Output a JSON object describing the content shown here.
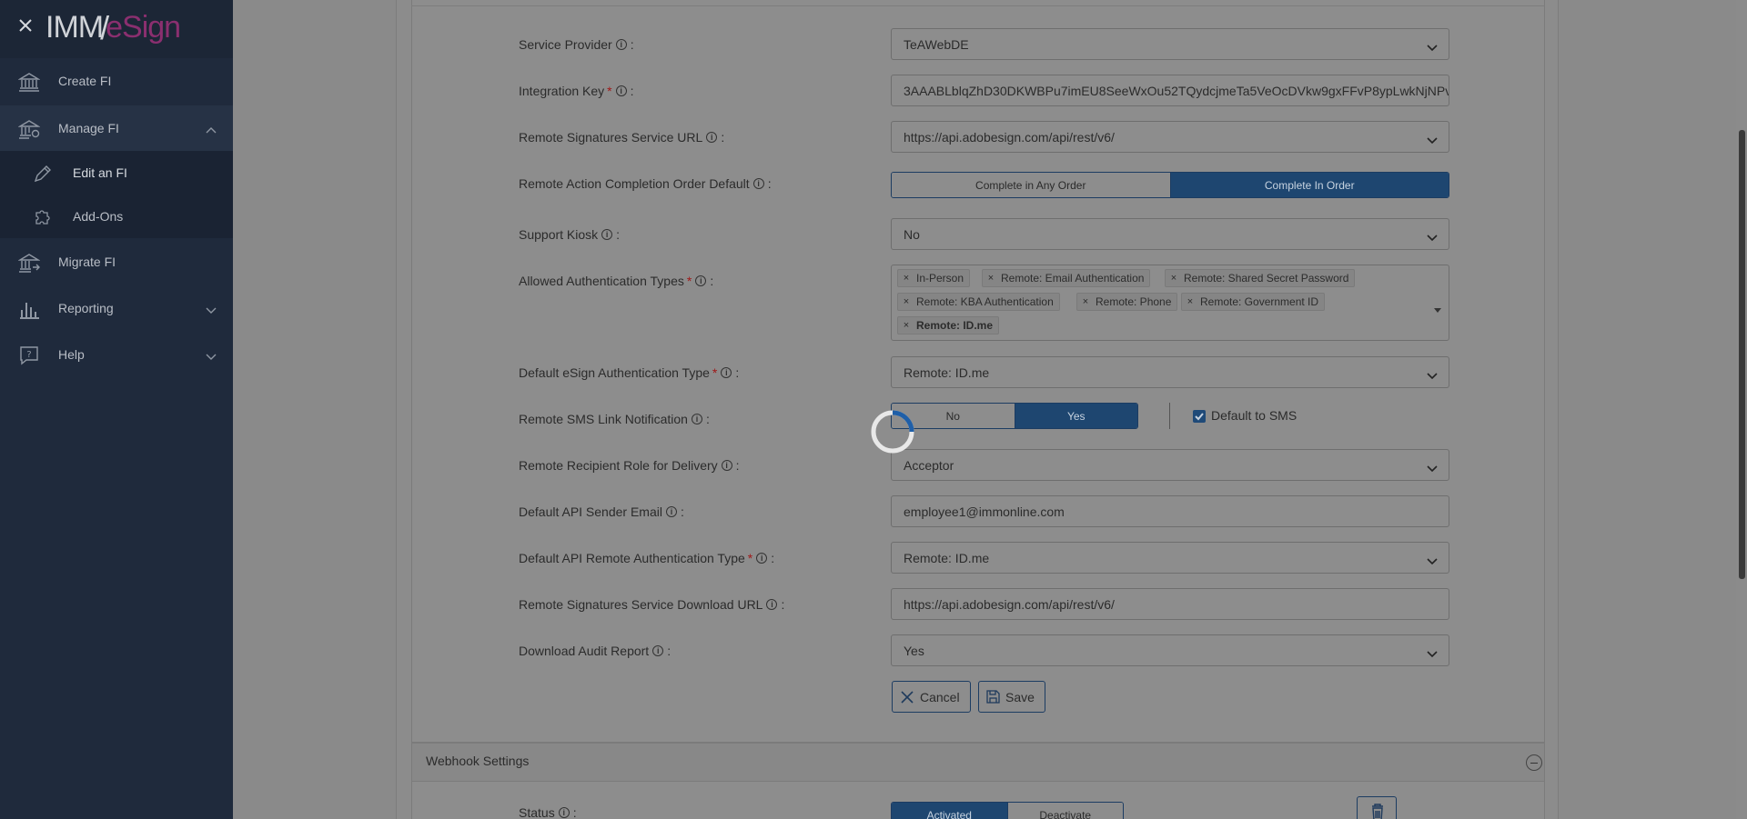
{
  "sidebar": {
    "logo": {
      "part1": "IMM",
      "slash": "/",
      "part2": "eSign"
    },
    "items": [
      {
        "label": "Create FI",
        "icon": "bank-icon"
      },
      {
        "label": "Manage FI",
        "icon": "bank-gear-icon"
      },
      {
        "label": "Migrate FI",
        "icon": "bank-arrow-icon"
      },
      {
        "label": "Reporting",
        "icon": "bar-chart-icon"
      },
      {
        "label": "Help",
        "icon": "help-bubble-icon"
      }
    ],
    "sub_items": [
      {
        "label": "Edit an FI",
        "icon": "pencil-icon"
      },
      {
        "label": "Add-Ons",
        "icon": "puzzle-icon"
      }
    ]
  },
  "form": {
    "service_provider": {
      "label": "Service Provider",
      "value": "TeAWebDE"
    },
    "integration_key": {
      "label": "Integration Key",
      "value": "3AAABLblqZhD30DKWBPu7imEU8SeeWxOu52TQydcjmeTa5VeOcDVkw9gxFFvP8ypLwkNjNPv"
    },
    "service_url": {
      "label": "Remote Signatures Service URL",
      "value": "https://api.adobesign.com/api/rest/v6/"
    },
    "completion_order": {
      "label": "Remote Action Completion Order Default",
      "options": [
        "Complete in Any Order",
        "Complete In Order"
      ],
      "selected": "Complete In Order"
    },
    "support_kiosk": {
      "label": "Support Kiosk",
      "value": "No"
    },
    "auth_types": {
      "label": "Allowed Authentication Types",
      "chips": [
        "In-Person",
        "Remote: Email Authentication",
        "Remote: Shared Secret Password",
        "Remote: KBA Authentication",
        "Remote: Phone",
        "Remote: Government ID",
        "Remote: ID.me"
      ]
    },
    "default_auth": {
      "label": "Default eSign Authentication Type",
      "value": "Remote: ID.me"
    },
    "sms_notification": {
      "label": "Remote SMS Link Notification",
      "options": [
        "No",
        "Yes"
      ],
      "selected": "Yes",
      "checkbox_label": "Default to SMS",
      "checked": true
    },
    "recipient_role": {
      "label": "Remote Recipient Role for Delivery",
      "value": "Acceptor"
    },
    "sender_email": {
      "label": "Default API Sender Email",
      "value": "employee1@immonline.com"
    },
    "api_remote_auth": {
      "label": "Default API Remote Authentication Type",
      "value": "Remote: ID.me"
    },
    "download_url": {
      "label": "Remote Signatures Service Download URL",
      "value": "https://api.adobesign.com/api/rest/v6/"
    },
    "audit_report": {
      "label": "Download Audit Report",
      "value": "Yes"
    },
    "cancel_label": "Cancel",
    "save_label": "Save"
  },
  "webhook": {
    "title": "Webhook Settings",
    "status_label": "Status",
    "options": [
      "Activated",
      "Deactivate"
    ],
    "selected": "Activated"
  }
}
